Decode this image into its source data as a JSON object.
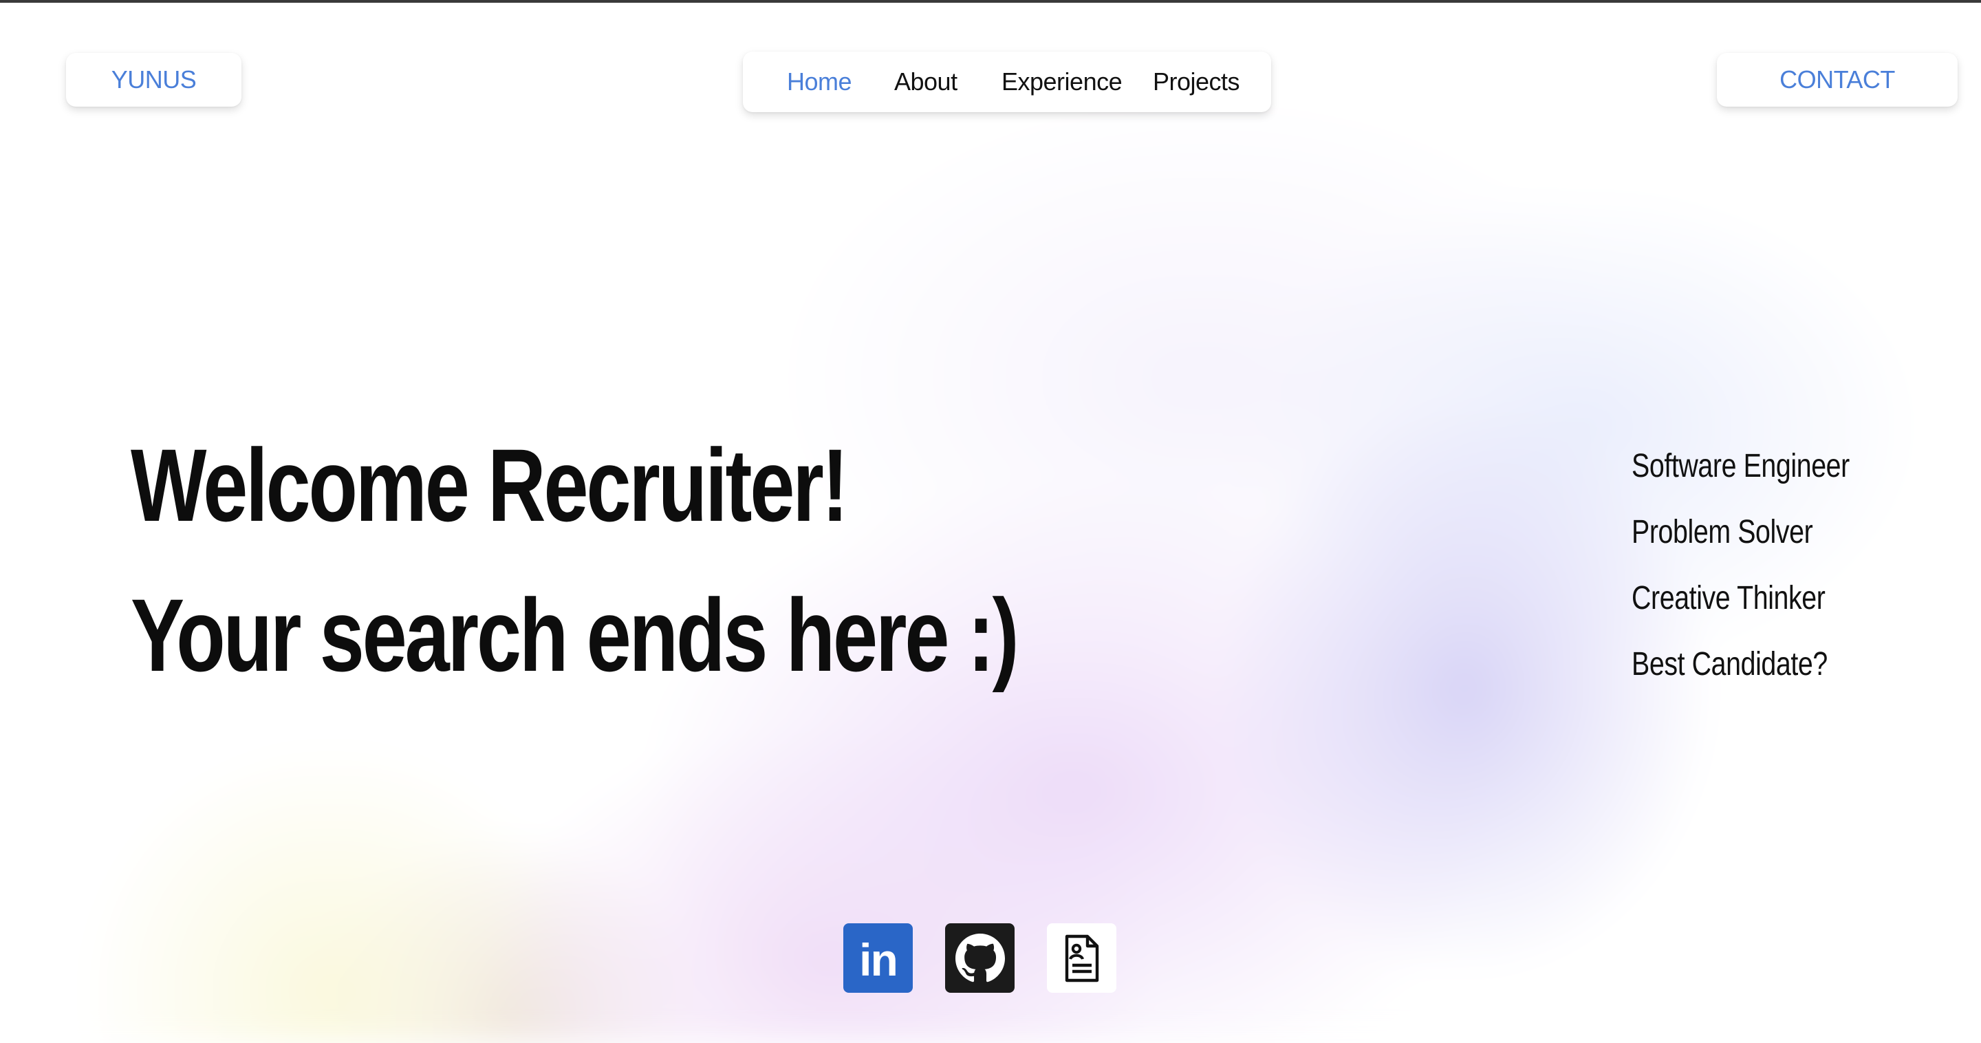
{
  "header": {
    "brand": "YUNUS",
    "contact_label": "CONTACT",
    "nav": [
      {
        "label": "Home",
        "active": true
      },
      {
        "label": "About",
        "active": false
      },
      {
        "label": "Experience",
        "active": false
      },
      {
        "label": "Projects",
        "active": false
      }
    ]
  },
  "hero": {
    "line1": "Welcome Recruiter!",
    "line2": "Your search ends here :)",
    "roles": [
      "Software Engineer",
      "Problem Solver",
      "Creative Thinker",
      "Best Candidate?"
    ]
  },
  "socials": [
    {
      "icon": "linkedin-icon",
      "label": "in",
      "color": "#2a66c7"
    },
    {
      "icon": "github-icon",
      "color": "#1b1b1b"
    },
    {
      "icon": "resume-icon",
      "color": "#ffffff"
    }
  ],
  "colors": {
    "accent": "#4a7fd9",
    "text": "#0d0d0d"
  }
}
